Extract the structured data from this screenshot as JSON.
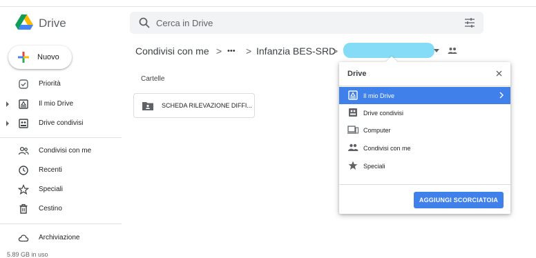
{
  "app": {
    "name": "Drive"
  },
  "search": {
    "placeholder": "Cerca in Drive"
  },
  "sidebar": {
    "new_label": "Nuovo",
    "items": [
      {
        "label": "Priorità",
        "icon": "check-circle-icon"
      },
      {
        "label": "Il mio Drive",
        "icon": "my-drive-icon"
      },
      {
        "label": "Drive condivisi",
        "icon": "shared-drives-icon"
      },
      {
        "label": "Condivisi con me",
        "icon": "people-icon"
      },
      {
        "label": "Recenti",
        "icon": "clock-icon"
      },
      {
        "label": "Speciali",
        "icon": "star-outline-icon"
      },
      {
        "label": "Cestino",
        "icon": "trash-icon"
      },
      {
        "label": "Archiviazione",
        "icon": "cloud-icon"
      }
    ],
    "storage_text": "5.89 GB in uso"
  },
  "breadcrumb": {
    "items": [
      "Condivisi con me",
      "•••",
      "Infanzia BES-SRD"
    ],
    "separator": ">"
  },
  "main": {
    "section_title": "Cartelle",
    "folders": [
      {
        "name": "SCHEDA RILEVAZIONE DIFFI..."
      }
    ]
  },
  "popup": {
    "title": "Drive",
    "items": [
      {
        "label": "Il mio Drive",
        "icon": "my-drive-icon",
        "active": true
      },
      {
        "label": "Drive condivisi",
        "icon": "shared-drives-icon"
      },
      {
        "label": "Computer",
        "icon": "computer-icon"
      },
      {
        "label": "Condivisi con me",
        "icon": "people-icon"
      },
      {
        "label": "Speciali",
        "icon": "star-icon"
      }
    ],
    "button_label": "AGGIUNGI SCORCIATOIA"
  },
  "colors": {
    "accent": "#3f80ea",
    "redacted_highlight": "#6fd6f5"
  }
}
